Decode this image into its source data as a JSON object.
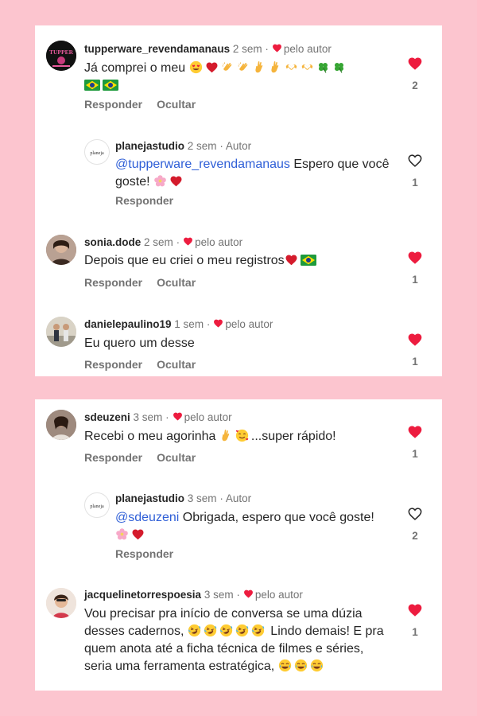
{
  "actions": {
    "reply": "Responder",
    "hide": "Ocultar"
  },
  "card1": [
    {
      "user": "tupperware_revendamanaus",
      "time": "2 sem",
      "badge": "pelo autor",
      "text": "Já comprei o meu",
      "likes": "2",
      "avatar_text": "TUPPER"
    },
    {
      "user": "planejastudio",
      "time": "2 sem",
      "badge": "Autor",
      "mention": "@tupperware_revendamanaus",
      "text": " Espero que você goste!",
      "likes": "1",
      "avatar_text": "planeja"
    },
    {
      "user": "sonia.dode",
      "time": "2 sem",
      "badge": "pelo autor",
      "text": "Depois que eu criei o meu registros",
      "likes": "1"
    },
    {
      "user": "danielepaulino19",
      "time": "1 sem",
      "badge": "pelo autor",
      "text": "Eu quero um desse",
      "likes": "1"
    }
  ],
  "card2": [
    {
      "user": "sdeuzeni",
      "time": "3 sem",
      "badge": "pelo autor",
      "text": "Recebi o meu agorinha",
      "text_after": "...super rápido!",
      "likes": "1"
    },
    {
      "user": "planejastudio",
      "time": "3 sem",
      "badge": "Autor",
      "mention": "@sdeuzeni",
      "text": " Obrigada, espero que você goste!",
      "likes": "2",
      "avatar_text": "planeja"
    },
    {
      "user": "jacquelinetorrespoesia",
      "time": "3 sem",
      "badge": "pelo autor",
      "text": "Vou precisar pra início de conversa se uma dúzia desses cadernos,",
      "text_mid": " Lindo demais! E pra quem anota até a ficha técnica de filmes e séries, seria uma ferramenta estratégica,",
      "likes": "1"
    }
  ],
  "colors": {
    "background": "#fcc5cf",
    "heart": "#ed1c3f",
    "mention": "#2f5fd7"
  }
}
